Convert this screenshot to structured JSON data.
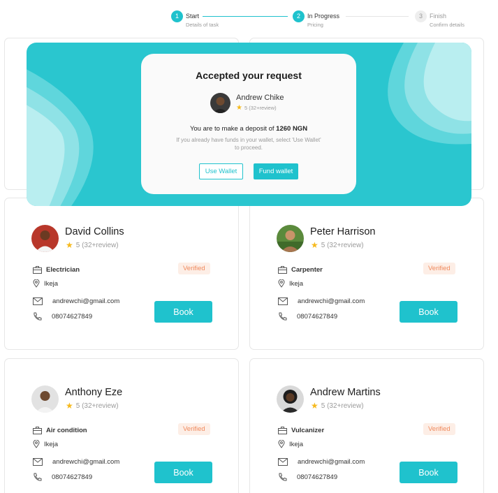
{
  "stepper": {
    "steps": [
      {
        "num": "1",
        "label": "Start",
        "sub": "Details of task"
      },
      {
        "num": "2",
        "label": "In Progress",
        "sub": "Pricing"
      },
      {
        "num": "3",
        "label": "Finish",
        "sub": "Confirm details"
      }
    ]
  },
  "modal": {
    "title": "Accepted your request",
    "provider_name": "Andrew Chike",
    "provider_rating": "5 (32+review)",
    "deposit_prefix": "You are to make a deposit of ",
    "deposit_amount": "1260 NGN",
    "hint": "If you already have funds in your wallet, select 'Use Wallet' to proceed.",
    "use_wallet_label": "Use Wallet",
    "fund_wallet_label": "Fund wallet"
  },
  "cards": [
    {
      "name": "David Collins",
      "rating": "5 (32+review)",
      "profession": "Electrician",
      "location": "Ikeja",
      "email": "andrewchi@gmail.com",
      "phone": "08074627849",
      "badge": "Verified",
      "book_label": "Book"
    },
    {
      "name": "Peter Harrison",
      "rating": "5 (32+review)",
      "profession": "Carpenter",
      "location": "Ikeja",
      "email": "andrewchi@gmail.com",
      "phone": "08074627849",
      "badge": "Verified",
      "book_label": "Book"
    },
    {
      "name": "Anthony Eze",
      "rating": "5 (32+review)",
      "profession": "Air condition",
      "location": "Ikeja",
      "email": "andrewchi@gmail.com",
      "phone": "08074627849",
      "badge": "Verified",
      "book_label": "Book"
    },
    {
      "name": "Andrew Martins",
      "rating": "5 (32+review)",
      "profession": "Vulcanizer",
      "location": "Ikeja",
      "email": "andrewchi@gmail.com",
      "phone": "08074627849",
      "badge": "Verified",
      "book_label": "Book"
    }
  ],
  "colors": {
    "accent": "#1fc2cd",
    "banner": "#2ac6cf",
    "verified_bg": "#fdeee6",
    "verified_text": "#ef8a5d",
    "star": "#f6b91c"
  }
}
